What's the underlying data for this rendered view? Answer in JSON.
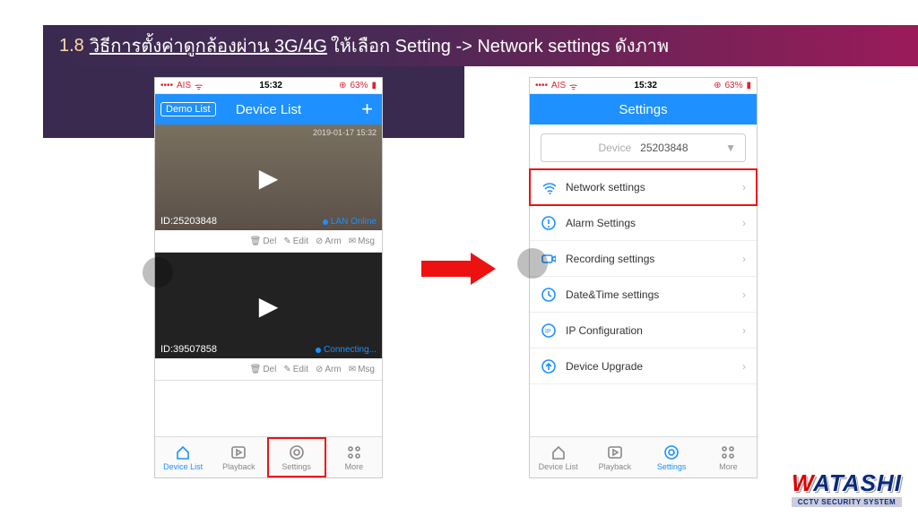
{
  "banner": {
    "step": "1.8",
    "underlined": "วิธีการตั้งค่าดูกล้องผ่าน 3G/4G",
    "rest": "ให้เลือก Setting -> Network settings ดังภาพ"
  },
  "statusbar": {
    "carrier": "AIS",
    "signal": "●●●●",
    "wifi": "⏚",
    "time": "15:32",
    "alarm": "⏰",
    "batt_pct": "63%"
  },
  "phone1": {
    "nav": {
      "back": "Demo List",
      "title": "Device List",
      "plus": "+"
    },
    "devices": [
      {
        "id_label": "ID:25203848",
        "timestamp": "2019-01-17 15:32",
        "status_text": "LAN Online",
        "status_class": "online"
      },
      {
        "id_label": "ID:39507858",
        "timestamp": "",
        "status_text": "Connecting...",
        "status_class": "connecting"
      }
    ],
    "actions": {
      "del": "Del",
      "edit": "Edit",
      "arm": "Arm",
      "msg": "Msg"
    }
  },
  "phone2": {
    "nav": {
      "title": "Settings"
    },
    "selector": {
      "label": "Device",
      "value": "25203848"
    },
    "rows": [
      {
        "icon": "wifi",
        "label": "Network settings",
        "highlight": true
      },
      {
        "icon": "alert",
        "label": "Alarm Settings",
        "highlight": false
      },
      {
        "icon": "camera",
        "label": "Recording settings",
        "highlight": false
      },
      {
        "icon": "clock",
        "label": "Date&Time settings",
        "highlight": false
      },
      {
        "icon": "ip",
        "label": "IP Configuration",
        "highlight": false
      },
      {
        "icon": "upgrade",
        "label": "Device Upgrade",
        "highlight": false
      }
    ]
  },
  "tabs": [
    {
      "key": "device",
      "label": "Device List",
      "icon": "home"
    },
    {
      "key": "playback",
      "label": "Playback",
      "icon": "play"
    },
    {
      "key": "settings",
      "label": "Settings",
      "icon": "gear"
    },
    {
      "key": "more",
      "label": "More",
      "icon": "more"
    }
  ],
  "logo": {
    "brand_w": "W",
    "brand_rest": "ATASHI",
    "tag": "CCTV SECURITY SYSTEM"
  }
}
